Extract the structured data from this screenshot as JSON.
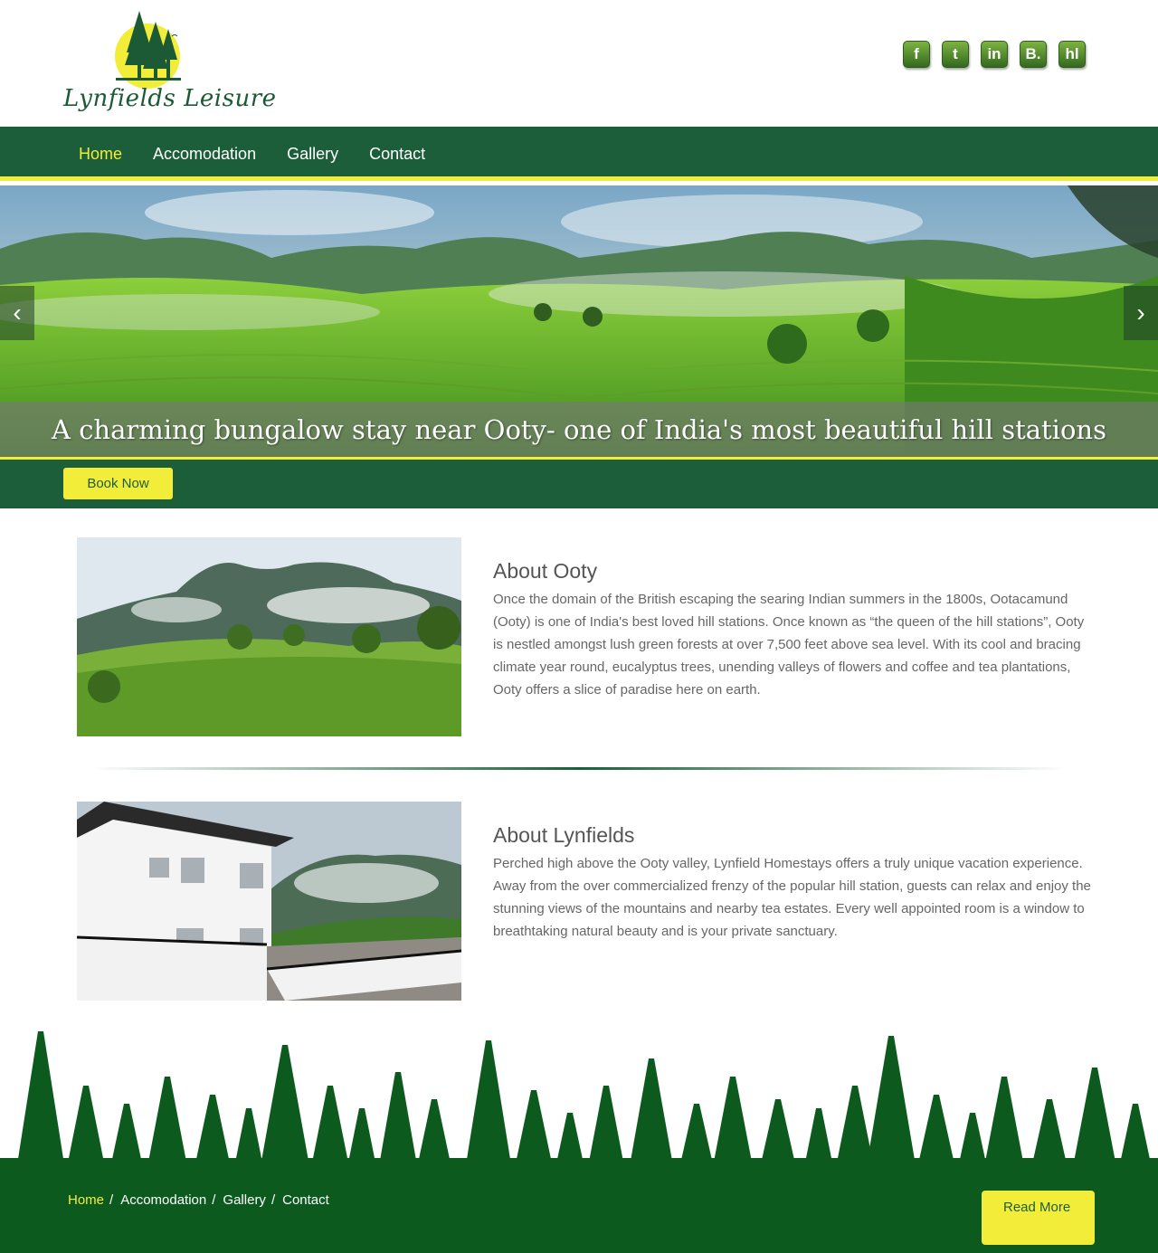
{
  "header": {
    "brand": "Lynfields Leisure",
    "social": [
      {
        "icon": "facebook-icon",
        "glyph": "f"
      },
      {
        "icon": "twitter-icon",
        "glyph": "t"
      },
      {
        "icon": "linkedin-icon",
        "glyph": "in"
      },
      {
        "icon": "booking-icon",
        "glyph": "B."
      },
      {
        "icon": "hotels-icon",
        "glyph": "hl"
      }
    ]
  },
  "nav": {
    "items": [
      "Home",
      "Accomodation",
      "Gallery",
      "Contact"
    ],
    "active": "Home"
  },
  "hero": {
    "caption": "A charming bungalow stay near Ooty- one of India's most beautiful hill stations",
    "prev": "‹",
    "next": "›"
  },
  "book": {
    "label": "Book Now"
  },
  "about_ooty": {
    "title": "About Ooty",
    "text": "Once the domain of the British escaping the searing Indian summers in the 1800s, Ootacamund (Ooty) is one of India's best loved hill stations. Once known as “the queen of the hill stations”, Ooty is nestled amongst lush green forests at over 7,500 feet above sea level. With its cool and bracing climate year round, eucalyptus trees, unending valleys of flowers and coffee and tea plantations, Ooty offers a slice of paradise here on earth."
  },
  "about_lynfields": {
    "title": "About Lynfields",
    "text": "Perched high above the Ooty valley, Lynfield Homestays offers a truly unique vacation experience. Away from the over commercialized frenzy of the popular hill station, guests can relax and enjoy the stunning views of the mountains and nearby tea estates. Every well appointed room is a window to breathtaking natural beauty and is your private sanctuary."
  },
  "footer": {
    "links": [
      "Home",
      "Accomodation",
      "Gallery",
      "Contact"
    ],
    "separator": "/",
    "read_more": "Read More"
  },
  "colors": {
    "brand_green": "#1c5e3a",
    "accent_yellow": "#f2ed38",
    "footer_green": "#0d5a1e"
  }
}
